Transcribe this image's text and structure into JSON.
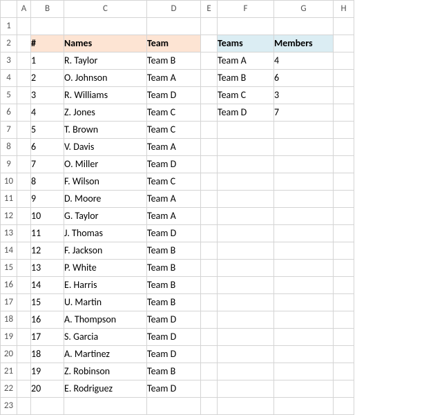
{
  "cols": [
    "A",
    "B",
    "C",
    "D",
    "E",
    "F",
    "G",
    "H"
  ],
  "rowCount": 23,
  "table1": {
    "headers": {
      "num": "#",
      "names": "Names",
      "team": "Team"
    },
    "rows": [
      {
        "n": "1",
        "name": "R. Taylor",
        "team": "Team B"
      },
      {
        "n": "2",
        "name": "O. Johnson",
        "team": "Team A"
      },
      {
        "n": "3",
        "name": "R. Williams",
        "team": "Team D"
      },
      {
        "n": "4",
        "name": "Z. Jones",
        "team": "Team C"
      },
      {
        "n": "5",
        "name": "T. Brown",
        "team": "Team C"
      },
      {
        "n": "6",
        "name": "V. Davis",
        "team": "Team A"
      },
      {
        "n": "7",
        "name": "O. Miller",
        "team": "Team D"
      },
      {
        "n": "8",
        "name": "F. Wilson",
        "team": "Team C"
      },
      {
        "n": "9",
        "name": "D. Moore",
        "team": "Team A"
      },
      {
        "n": "10",
        "name": "G. Taylor",
        "team": "Team A"
      },
      {
        "n": "11",
        "name": "J. Thomas",
        "team": "Team D"
      },
      {
        "n": "12",
        "name": "F. Jackson",
        "team": "Team B"
      },
      {
        "n": "13",
        "name": "P. White",
        "team": "Team B"
      },
      {
        "n": "14",
        "name": "E. Harris",
        "team": "Team B"
      },
      {
        "n": "15",
        "name": "U. Martin",
        "team": "Team B"
      },
      {
        "n": "16",
        "name": "A. Thompson",
        "team": "Team D"
      },
      {
        "n": "17",
        "name": "S. Garcia",
        "team": "Team D"
      },
      {
        "n": "18",
        "name": "A. Martinez",
        "team": "Team D"
      },
      {
        "n": "19",
        "name": "Z. Robinson",
        "team": "Team B"
      },
      {
        "n": "20",
        "name": "E. Rodriguez",
        "team": "Team D"
      }
    ]
  },
  "table2": {
    "headers": {
      "teams": "Teams",
      "members": "Members"
    },
    "rows": [
      {
        "team": "Team A",
        "members": "4"
      },
      {
        "team": "Team B",
        "members": "6"
      },
      {
        "team": "Team C",
        "members": "3"
      },
      {
        "team": "Team D",
        "members": "7"
      }
    ]
  }
}
